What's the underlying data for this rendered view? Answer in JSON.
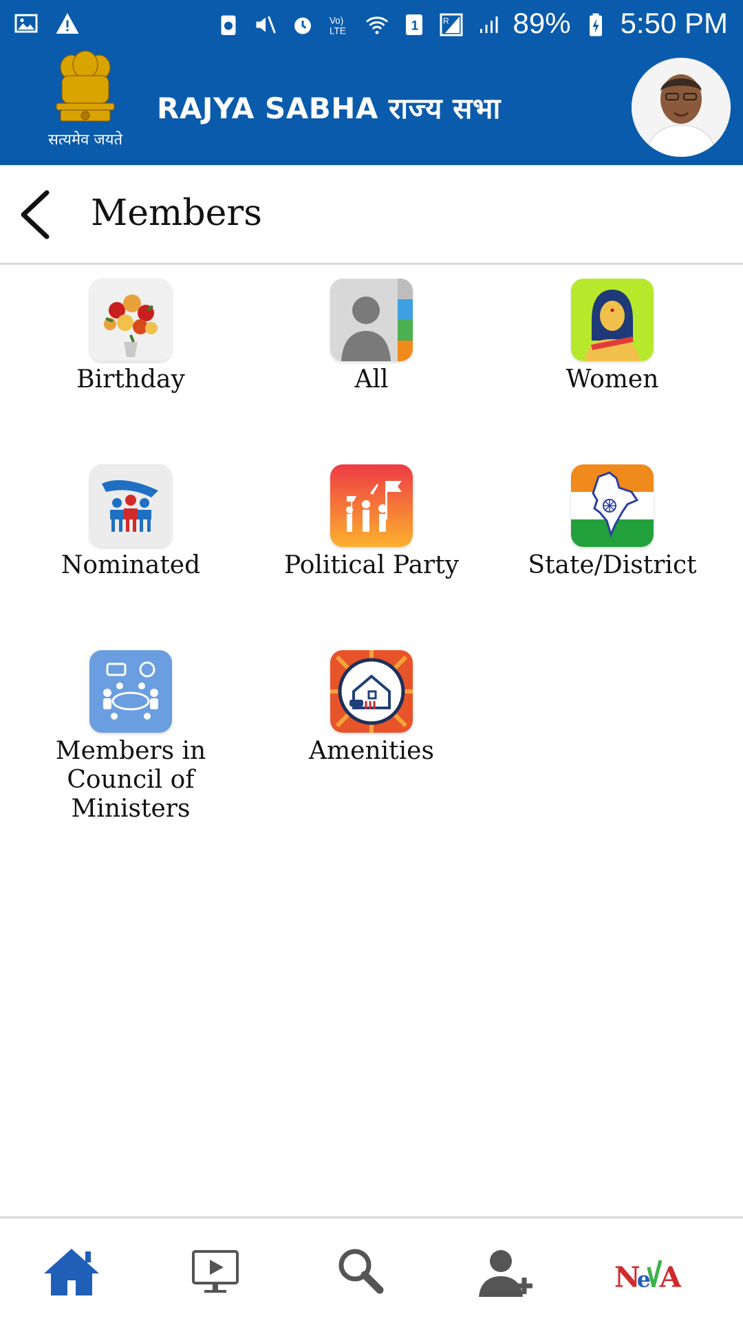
{
  "status_bar": {
    "battery": "89%",
    "time": "5:50 PM",
    "left_icons": [
      "gallery-icon",
      "warning-icon"
    ],
    "right_icons": [
      "sim-toolkit-icon",
      "mute-icon",
      "alarm-icon",
      "volte-icon",
      "wifi-icon",
      "sim-1-icon",
      "signal-r-icon",
      "signal-r2-icon",
      "battery-charging-icon"
    ]
  },
  "header": {
    "emblem_motto": "सत्यमेव जयते",
    "title": "RAJYA SABHA राज्य सभा",
    "background_color": "#0a5bab"
  },
  "page": {
    "title": "Members"
  },
  "tiles": [
    {
      "label": "Birthday",
      "icon": "flower-bouquet-icon"
    },
    {
      "label": "All",
      "icon": "contacts-directory-icon"
    },
    {
      "label": "Women",
      "icon": "woman-icon"
    },
    {
      "label": "Nominated",
      "icon": "nominated-people-icon"
    },
    {
      "label": "Political Party",
      "icon": "party-flags-icon"
    },
    {
      "label": "State/District",
      "icon": "india-map-icon"
    },
    {
      "label": "Members in Council of Ministers",
      "icon": "meeting-table-icon"
    },
    {
      "label": "Amenities",
      "icon": "house-amenities-icon"
    }
  ],
  "bottom_nav": {
    "items": [
      "home-icon",
      "video-icon",
      "search-icon",
      "add-user-icon",
      "neva-logo"
    ],
    "neva_text": "NeVA"
  }
}
